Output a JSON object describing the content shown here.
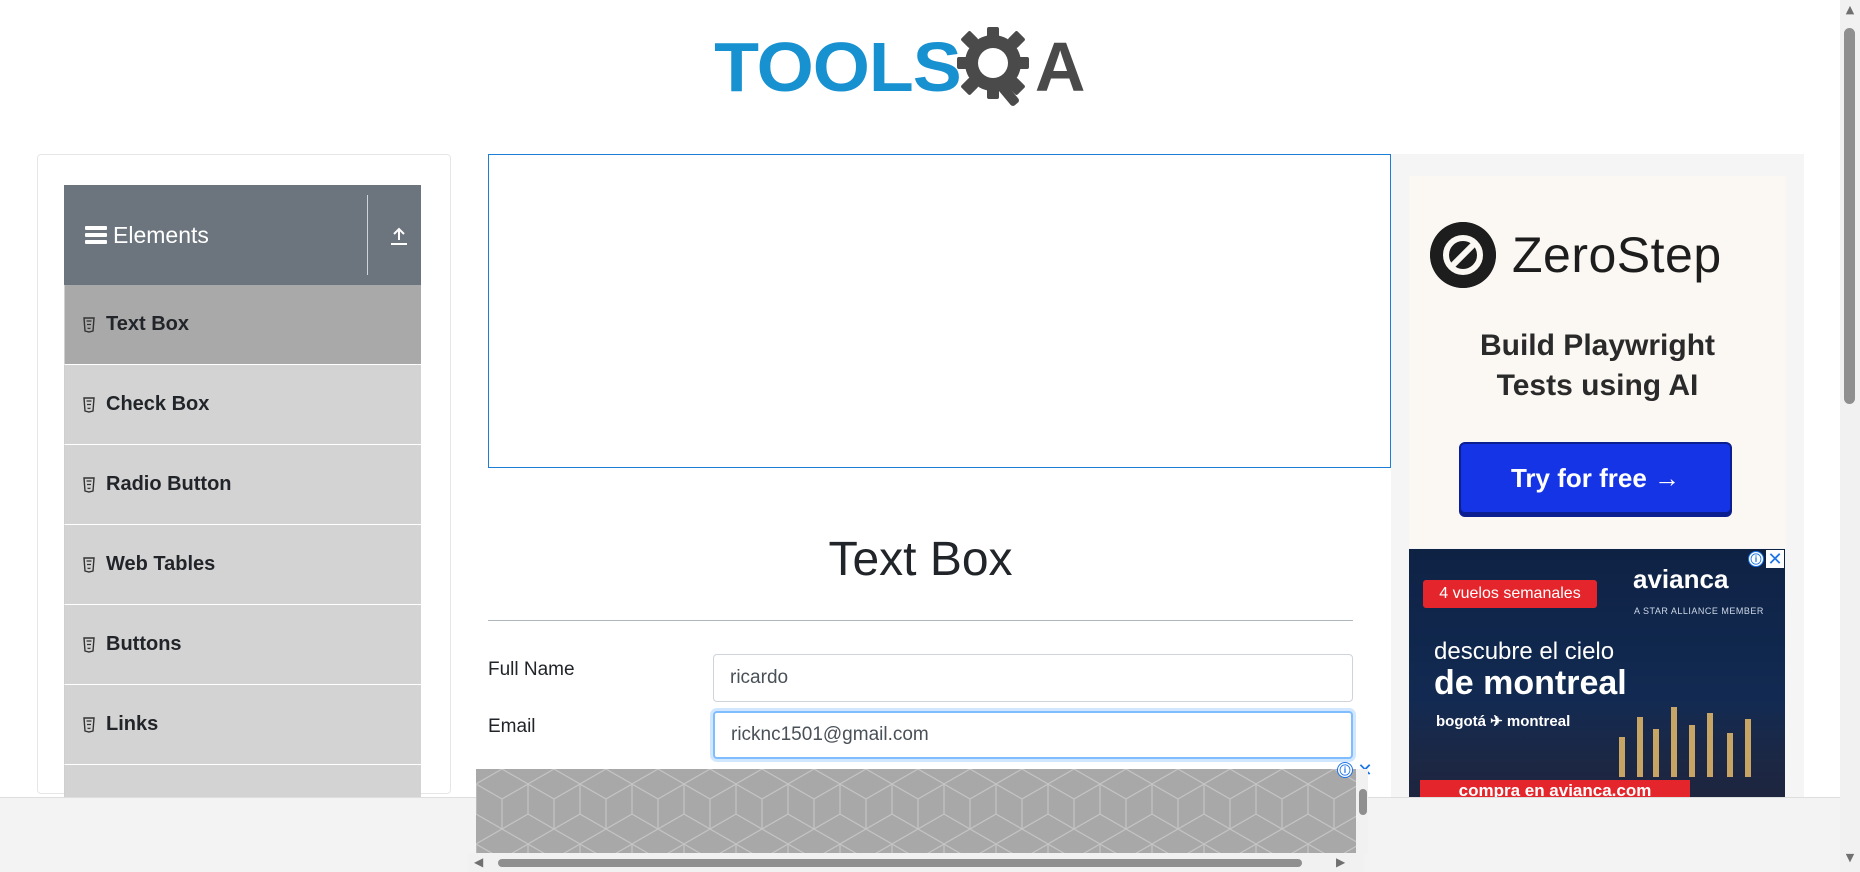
{
  "header": {
    "logo_text_left": "TOOLS",
    "logo_text_right": "A",
    "logo_icon": "gear-magnifier-icon"
  },
  "sidebar": {
    "group_title": "Elements",
    "group_icon": "hamburger-icon",
    "collapse_icon": "upload-arrow-icon",
    "items": [
      {
        "label": "Text Box",
        "icon": "html-file-icon",
        "active": true
      },
      {
        "label": "Check Box",
        "icon": "html-file-icon",
        "active": false
      },
      {
        "label": "Radio Button",
        "icon": "html-file-icon",
        "active": false
      },
      {
        "label": "Web Tables",
        "icon": "html-file-icon",
        "active": false
      },
      {
        "label": "Buttons",
        "icon": "html-file-icon",
        "active": false
      },
      {
        "label": "Links",
        "icon": "html-file-icon",
        "active": false
      }
    ]
  },
  "main": {
    "title": "Text Box",
    "form": {
      "full_name_label": "Full Name",
      "full_name_value": "ricardo",
      "email_label": "Email",
      "email_value": "ricknc1501@gmail.com"
    }
  },
  "ads": {
    "zerostep": {
      "brand": "ZeroStep",
      "tagline_line1": "Build Playwright",
      "tagline_line2": "Tests using AI",
      "cta": "Try for free →"
    },
    "avianca": {
      "pill": "4 vuelos semanales",
      "brand": "avianca",
      "sub": "A STAR ALLIANCE MEMBER",
      "line1": "descubre el cielo",
      "line2": "de montreal",
      "route": "bogotá ✈ montreal",
      "bottom": "compra en avianca.com"
    },
    "info_icon": "ⓘ",
    "close_icon": "✕"
  },
  "colors": {
    "brand_blue": "#1891d1",
    "sidebar_header": "#6c757d",
    "menu_item": "#d3d3d3",
    "menu_active": "#a9a9a9",
    "zerostep_cta": "#1534e5",
    "avianca_red": "#e4262c"
  }
}
